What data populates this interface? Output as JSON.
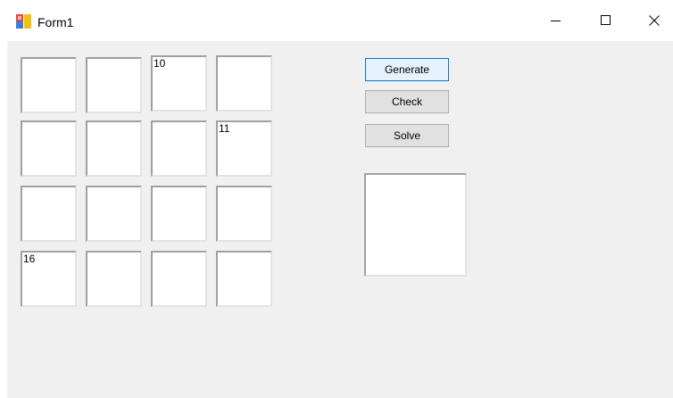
{
  "window": {
    "title": "Form1"
  },
  "grid": {
    "cells": [
      "",
      "",
      "10",
      "",
      "",
      "",
      "",
      "11",
      "",
      "",
      "",
      "",
      "16",
      "",
      "",
      ""
    ]
  },
  "buttons": {
    "generate_label": "Generate",
    "check_label": "Check",
    "solve_label": "Solve"
  },
  "output": {
    "value": ""
  },
  "icons": {
    "app": "form-app-icon",
    "minimize": "minimize-icon",
    "maximize": "maximize-icon",
    "close": "close-icon"
  }
}
